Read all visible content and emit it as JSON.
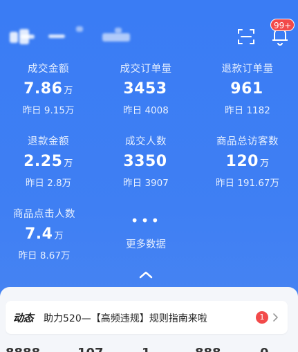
{
  "header": {
    "notification_badge": "99+",
    "scan_icon": "scan-icon",
    "bell_icon": "bell-icon"
  },
  "metrics": [
    {
      "label": "成交金额",
      "value": "7.86",
      "unit": "万",
      "yesterday": "昨日 9.15万"
    },
    {
      "label": "成交订单量",
      "value": "3453",
      "unit": "",
      "yesterday": "昨日 4008"
    },
    {
      "label": "退款订单量",
      "value": "961",
      "unit": "",
      "yesterday": "昨日 1182"
    },
    {
      "label": "退款金额",
      "value": "2.25",
      "unit": "万",
      "yesterday": "昨日 2.8万"
    },
    {
      "label": "成交人数",
      "value": "3350",
      "unit": "",
      "yesterday": "昨日 3907"
    },
    {
      "label": "商品总访客数",
      "value": "120",
      "unit": "万",
      "yesterday": "昨日 191.67万"
    },
    {
      "label": "商品点击人数",
      "value": "7.4",
      "unit": "万",
      "yesterday": "昨日 8.67万"
    }
  ],
  "more": {
    "label": "更多数据",
    "icon": "more-dots-icon"
  },
  "collapse_icon": "chevron-up-icon",
  "news": {
    "tag": "动态",
    "text": "助力520—【高频违规】规则指南来啦",
    "count": "1",
    "arrow_icon": "chevron-right-icon"
  },
  "colors": {
    "background": "#3a7cf4",
    "badge": "#f24a4a",
    "sheet": "#f4f6fa"
  }
}
